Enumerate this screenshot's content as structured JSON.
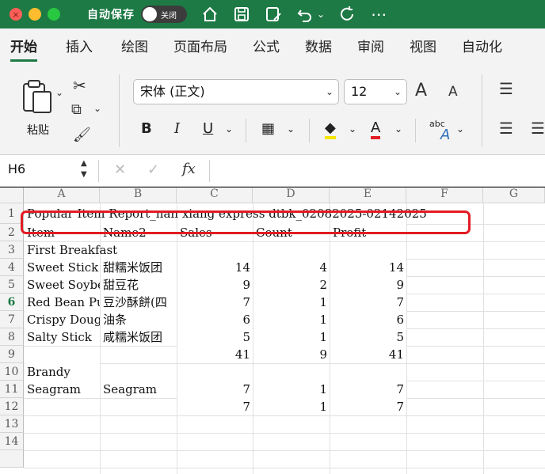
{
  "titlebar": {
    "autosave_label": "自动保存",
    "toggle_label": "关闭"
  },
  "tabs": [
    "开始",
    "插入",
    "绘图",
    "页面布局",
    "公式",
    "数据",
    "审阅",
    "视图",
    "自动化"
  ],
  "ribbon": {
    "paste_label": "粘贴",
    "font_name": "宋体 (正文)",
    "font_size": "12",
    "bold": "B",
    "italic": "I",
    "underline": "U",
    "grow": "A",
    "shrink": "A",
    "font_color_letter": "A",
    "abc": "abc"
  },
  "formula_bar": {
    "name_box": "H6",
    "fx": "fx",
    "cancel": "✕",
    "confirm": "✓"
  },
  "sheet": {
    "columns": [
      "A",
      "B",
      "C",
      "D",
      "E",
      "F",
      "G"
    ],
    "rows": [
      "1",
      "2",
      "3",
      "4",
      "5",
      "6",
      "7",
      "8",
      "9",
      "10",
      "11",
      "12",
      "13",
      "14"
    ],
    "cells": {
      "A1": "Popular Item Report_nan xiang express dtbk_02082025-02142025",
      "A2": "Item",
      "B2": "Name2",
      "C2": "Sales",
      "D2": "Count",
      "E2": "Profit",
      "A3": "First Breakfast",
      "A4": "Sweet Stick",
      "B4": "甜糯米饭团",
      "C4": "14",
      "D4": "4",
      "E4": "14",
      "A5": "Sweet Soybean",
      "B5": "甜豆花",
      "C5": "9",
      "D5": "2",
      "E5": "9",
      "A6": "Red Bean Puff",
      "B6": "豆沙酥餅(四",
      "C6": "7",
      "D6": "1",
      "E6": "7",
      "A7": "Crispy Dough",
      "B7": "油条",
      "C7": "6",
      "D7": "1",
      "E7": "6",
      "A8": "Salty Stick",
      "B8": "咸糯米饭团",
      "C8": "5",
      "D8": "1",
      "E8": "5",
      "C9": "41",
      "D9": "9",
      "E9": "41",
      "A10": "Brandy",
      "A11": "Seagram",
      "B11": "Seagram",
      "C11": "7",
      "D11": "1",
      "E11": "7",
      "C12": "7",
      "D12": "1",
      "E12": "7"
    }
  },
  "colors": {
    "excel_green": "#1d7a45",
    "highlight_red": "#e31b23"
  }
}
